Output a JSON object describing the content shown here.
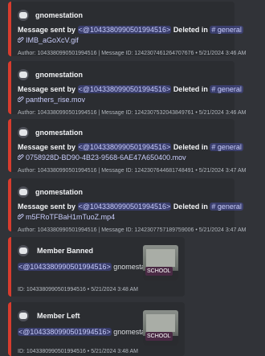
{
  "colors": {
    "embed_accent": "#d83c2e",
    "mention": "#c9cdfb",
    "background": "#313338"
  },
  "embeds": [
    {
      "author": "gnomestation",
      "prefix": "Message sent by",
      "user_mention": "<@1043380990501994516>",
      "deleted_in": "Deleted in",
      "channel": "# general",
      "attachment": "IMB_aGoXcV.gif",
      "footer": "Author: 1043380990501994516 | Message ID: 1242307461264707676 • 5/21/2024 3:46 AM"
    },
    {
      "author": "gnomestation",
      "prefix": "Message sent by",
      "user_mention": "<@1043380990501994516>",
      "deleted_in": "Deleted in",
      "channel": "# general",
      "attachment": "panthers_rise.mov",
      "footer": "Author: 1043380990501994516 | Message ID: 1242307532043849761 • 5/21/2024 3:46 AM"
    },
    {
      "author": "gnomestation",
      "prefix": "Message sent by",
      "user_mention": "<@1043380990501994516>",
      "deleted_in": "Deleted in",
      "channel": "# general",
      "attachment": "0758928D-BD90-4B23-9568-6AE47A650400.mov",
      "footer": "Author: 1043380990501994516 | Message ID: 1242307644681748491 • 5/21/2024 3:47 AM"
    },
    {
      "author": "gnomestation",
      "prefix": "Message sent by",
      "user_mention": "<@1043380990501994516>",
      "deleted_in": "Deleted in",
      "channel": "# general",
      "attachment": "m5FRoTFBaH1mTuoZ.mp4",
      "footer": "Author: 1043380990501994516 | Message ID: 1242307757189759006 • 5/21/2024 3:47 AM"
    }
  ],
  "mod_embeds": [
    {
      "title": "Member Banned",
      "user_mention": "<@1043380990501994516>",
      "username": "gnomestation",
      "thumb_label": "SCHOOL",
      "footer": "ID: 1043380990501994516 • 5/21/2024 3:48 AM"
    },
    {
      "title": "Member Left",
      "user_mention": "<@1043380990501994516>",
      "username": "gnomestation",
      "thumb_label": "SCHOOL",
      "footer": "ID: 1043380990501994516 • 5/21/2024 3:48 AM"
    }
  ]
}
